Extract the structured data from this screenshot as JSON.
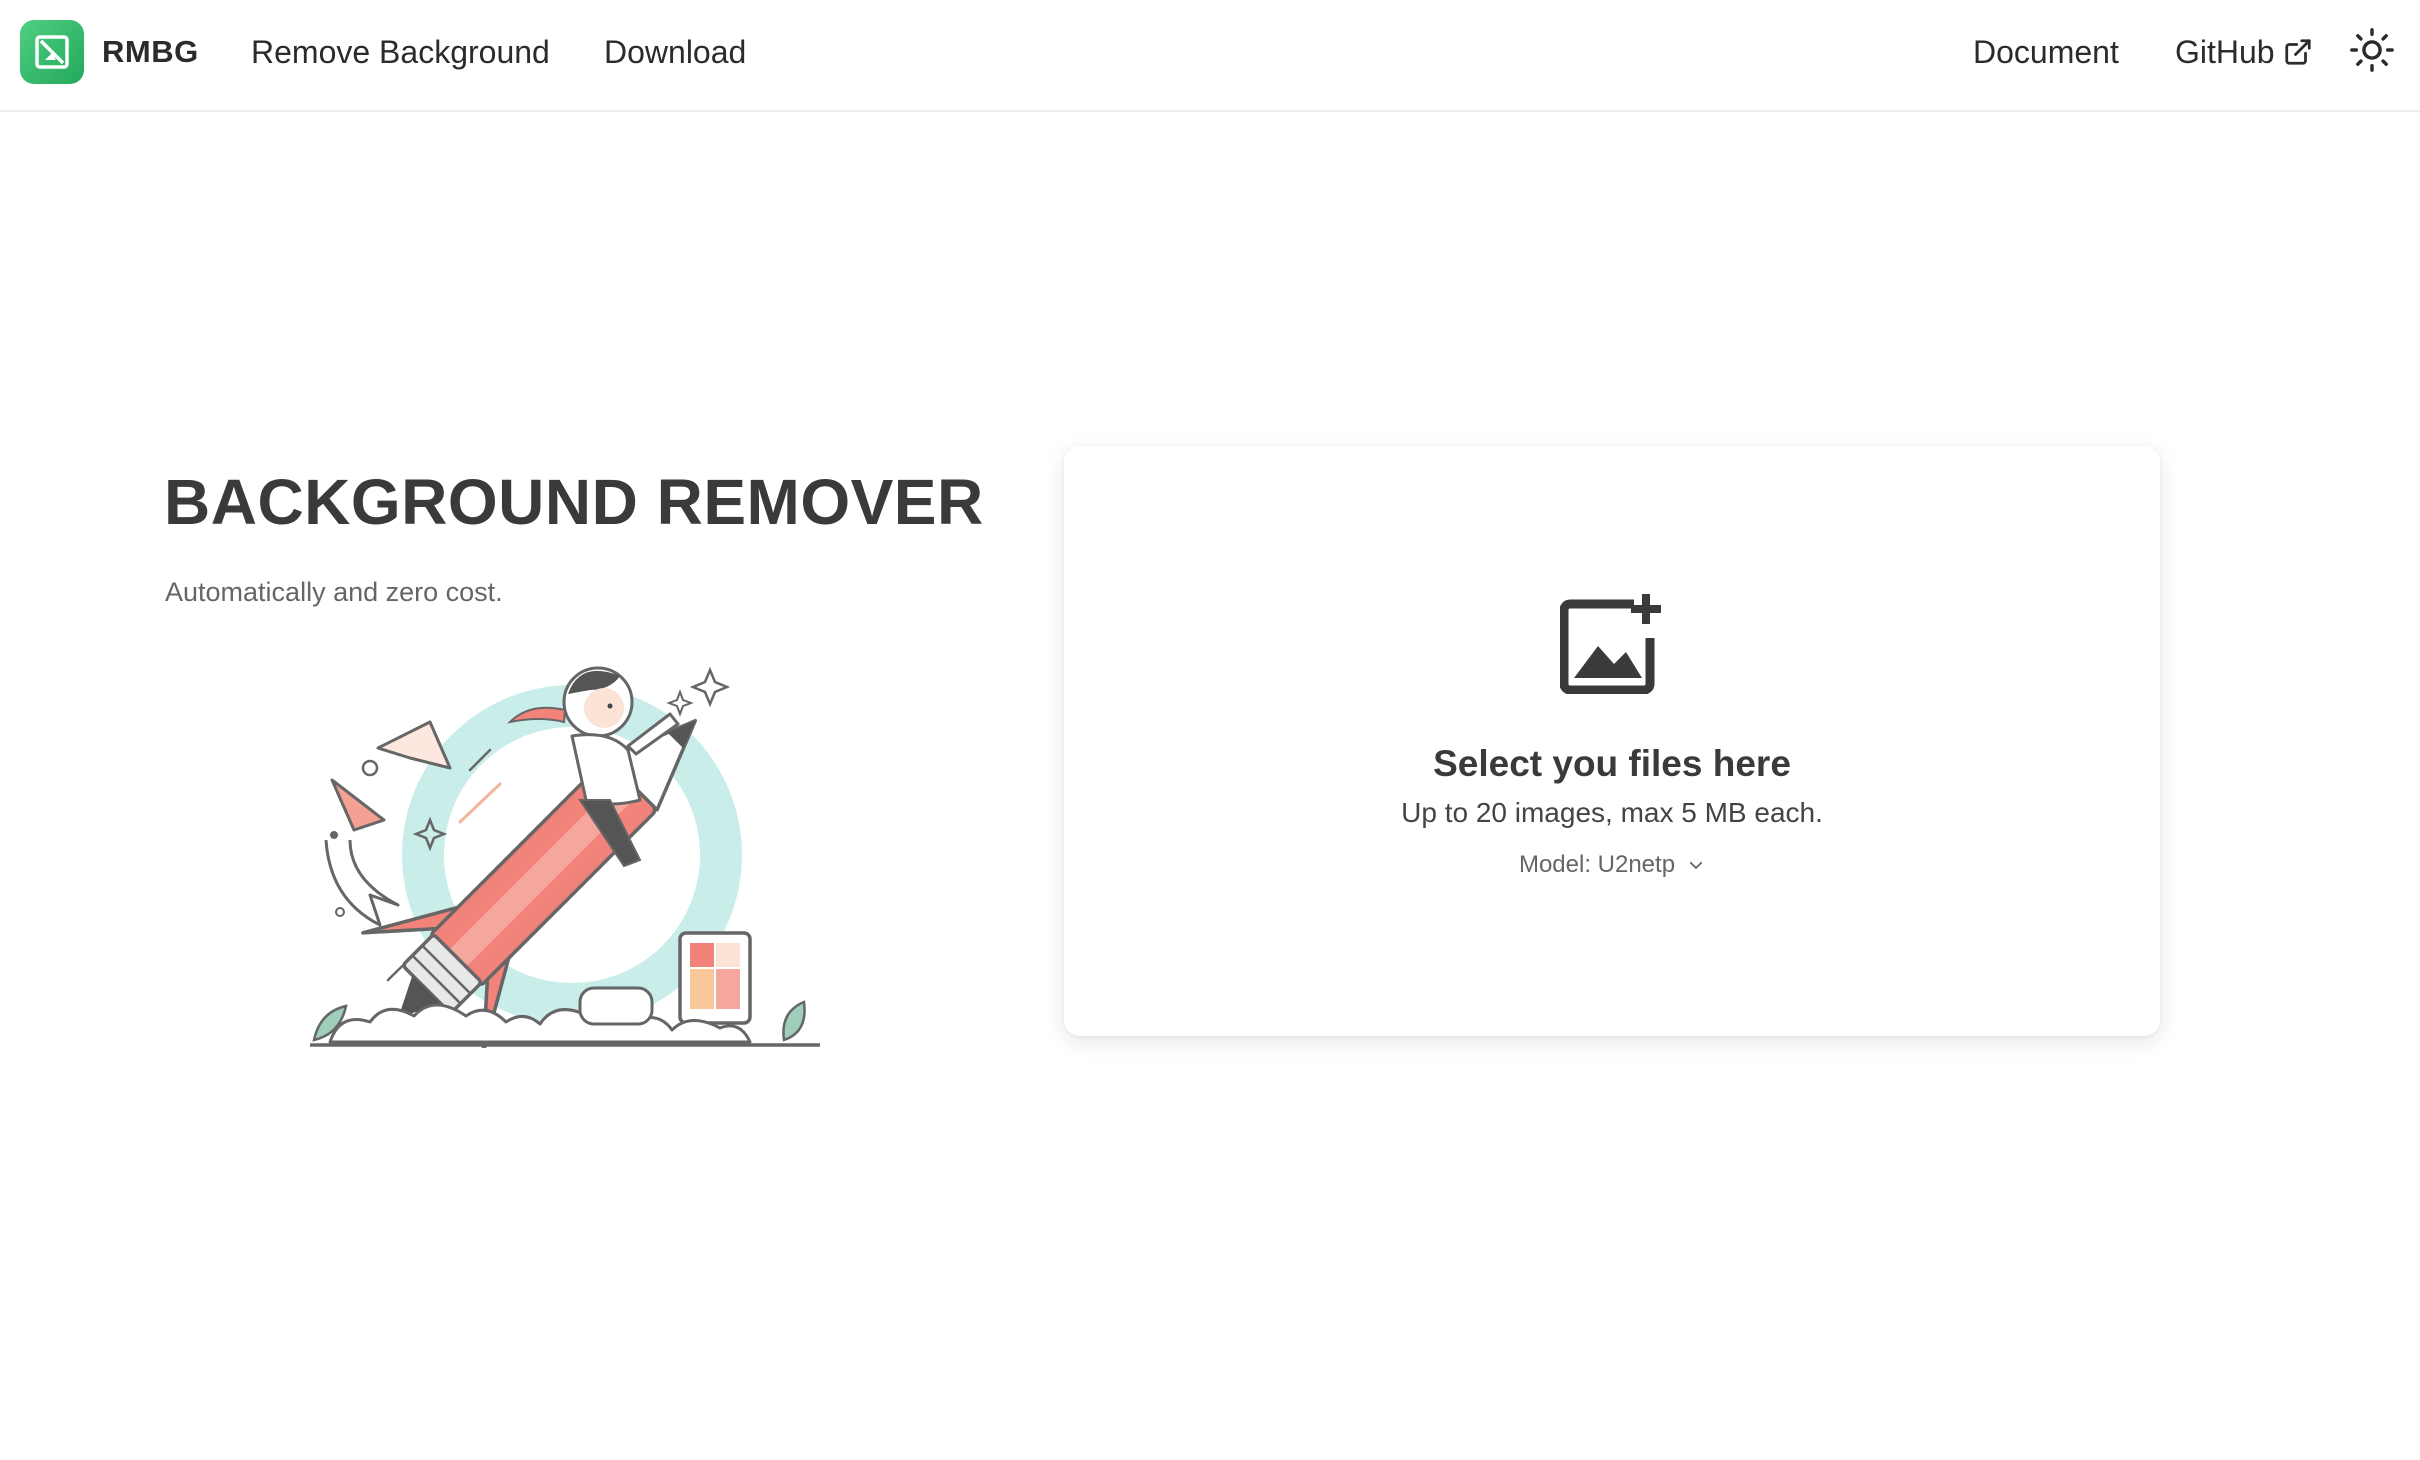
{
  "header": {
    "brand": "RMBG",
    "nav_left": [
      "Remove Background",
      "Download"
    ],
    "nav_right": {
      "document": "Document",
      "github": "GitHub"
    },
    "icons": {
      "logo": "rmbg-logo-icon",
      "external": "external-link-icon",
      "theme": "sun-icon"
    }
  },
  "hero": {
    "title": "BACKGROUND REMOVER",
    "subtitle": "Automatically and zero cost."
  },
  "upload": {
    "icon": "image-add-icon",
    "title": "Select you files here",
    "hint": "Up to 20 images, max 5 MB each.",
    "model_label": "Model: U2netp"
  },
  "colors": {
    "brand_green": "#2db56a",
    "text_dark": "#3a3a3a",
    "text_muted": "#666666",
    "illustration_teal": "#c6ece9",
    "illustration_coral": "#f08a7e"
  }
}
